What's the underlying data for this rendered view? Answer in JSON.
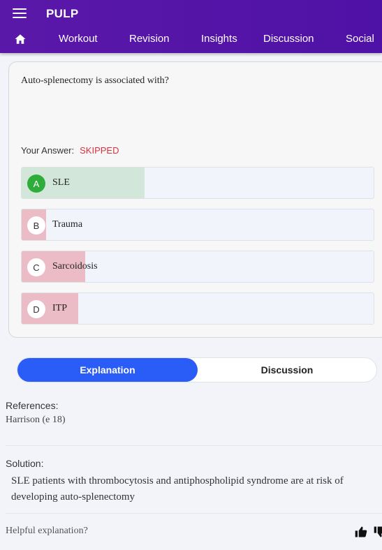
{
  "app": {
    "title": "PULP",
    "nav": [
      "Workout",
      "Revision",
      "Insights",
      "Discussion",
      "Social"
    ],
    "accent": "#5a18a8"
  },
  "question": {
    "text": "Auto-splenectomy is associated with?",
    "your_answer_label": "Your Answer:",
    "your_answer_value": "SKIPPED",
    "options": [
      {
        "letter": "A",
        "text": "SLE",
        "correct": true,
        "share": 0.35,
        "fill_color": "#d2e7d9"
      },
      {
        "letter": "B",
        "text": "Trauma",
        "correct": false,
        "share": 0.07,
        "fill_color": "#ebbcc5"
      },
      {
        "letter": "C",
        "text": "Sarcoidosis",
        "correct": false,
        "share": 0.18,
        "fill_color": "#ebbcc5"
      },
      {
        "letter": "D",
        "text": "ITP",
        "correct": false,
        "share": 0.16,
        "fill_color": "#ebbcc5"
      }
    ]
  },
  "tabs": {
    "explanation": "Explanation",
    "discussion": "Discussion",
    "active": "Explanation",
    "active_color": "#2a5cf7"
  },
  "explanation": {
    "references_label": "References:",
    "references_value": "Harrison (e 18)",
    "solution_label": "Solution:",
    "solution_text": "SLE patients with thrombocytosis and antiphospholipid syndrome are at risk of developing auto-splenectomy",
    "helpful_prompt": "Helpful explanation?"
  }
}
